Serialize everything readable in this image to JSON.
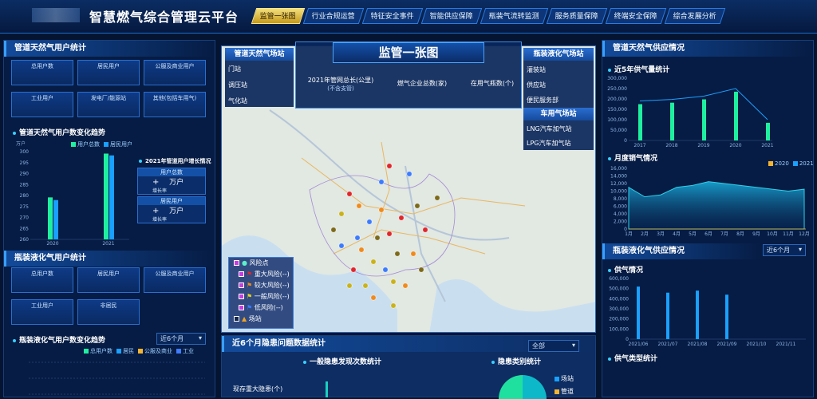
{
  "app": {
    "title": "智慧燃气综合管理云平台"
  },
  "nav": [
    "监管一张图",
    "行业合规运营",
    "特征安全事件",
    "智能供应保障",
    "瓶装气流转监测",
    "服务质量保障",
    "终端安全保障",
    "综合发展分析"
  ],
  "left": {
    "pipeline_title": "管道天然气用户统计",
    "pipeline_tiles": [
      "总用户数",
      "居民用户",
      "公服及商业用户",
      "工业用户",
      "发电厂/能源站",
      "其他(包括车用气)"
    ],
    "trend_title": "管道天然气用户数变化趋势",
    "trend_unit": "万户",
    "trend_legend": [
      "用户总数",
      "居民用户"
    ],
    "growth_title": "2021年管道用户增长情况",
    "growth_boxes": [
      {
        "label": "用户总数",
        "unit": "万户",
        "sub": "增长率"
      },
      {
        "label": "居民用户",
        "unit": "万户",
        "sub": "增长率"
      }
    ],
    "bottled_title": "瓶装液化气用户统计",
    "bottled_tiles": [
      "总用户数",
      "居民用户",
      "公服及商业用户",
      "工业用户",
      "非居民"
    ],
    "bottled_trend_title": "瓶装液化气用户数变化趋势",
    "bottled_select": "近6个月",
    "bottled_legend": [
      "总用户数",
      "居民",
      "公服及商业",
      "工业"
    ]
  },
  "map": {
    "title": "监管一张图",
    "stats": [
      {
        "label": "2021年管网总长(公里)",
        "sub": "(不含支管)"
      },
      {
        "label": "燃气企业总数(家)",
        "sub": ""
      },
      {
        "label": "在用气瓶数(个)",
        "sub": ""
      }
    ],
    "left_list_title": "管道天然气场站",
    "left_list": [
      "门站",
      "调压站",
      "气化站"
    ],
    "right_list_title": "瓶装液化气场站",
    "right_list": [
      "灌装站",
      "供应站",
      "便民服务部"
    ],
    "right_list2_title": "车用气场站",
    "right_list2": [
      "LNG汽车加气站",
      "LPG汽车加气站"
    ],
    "legend": [
      "风险点",
      "重大风险(--)",
      "较大风险(--)",
      "一般风险(--)",
      "低风险(--)",
      "场站"
    ]
  },
  "bottom": {
    "title": "近6个月隐患问题数据统计",
    "select": "全部",
    "sub1": "一般隐患发现次数统计",
    "sub2": "隐患类别统计",
    "major": "现存重大隐患(个)",
    "pie_legend": [
      "场站",
      "管道"
    ]
  },
  "right": {
    "title": "管道天然气供应情况",
    "sub1": "近5年供气量统计",
    "sub2": "月度销气情况",
    "bottled_title": "瓶装液化气供应情况",
    "bottled_select": "近6个月",
    "sub3": "供气情况",
    "sub4": "供气类型统计"
  },
  "chart_data": [
    {
      "type": "bar",
      "title": "管道天然气用户数变化趋势",
      "ylabel": "万户",
      "categories": [
        "2020",
        "2021"
      ],
      "series": [
        {
          "name": "用户总数",
          "values": [
            247,
            296
          ]
        },
        {
          "name": "居民用户",
          "values": [
            244,
            294
          ]
        }
      ],
      "ylim": [
        200,
        300
      ],
      "yticks": [
        "300",
        "295",
        "290",
        "285",
        "280",
        "275",
        "270",
        "265",
        "260"
      ]
    },
    {
      "type": "bar",
      "title": "近5年供气量统计",
      "categories": [
        "2017",
        "2018",
        "2019",
        "2020",
        "2021"
      ],
      "values": [
        175,
        182,
        198,
        235,
        85
      ],
      "ylim": [
        0,
        300
      ],
      "yticks": [
        "300,000",
        "250,000",
        "200,000",
        "150,000",
        "100,000",
        "50,000",
        "0"
      ]
    },
    {
      "type": "area",
      "title": "月度销气情况",
      "categories": [
        "1月",
        "2月",
        "3月",
        "4月",
        "5月",
        "6月",
        "7月",
        "8月",
        "9月",
        "10月",
        "11月",
        "12月"
      ],
      "series": [
        {
          "values": [
            11,
            8.5,
            9,
            11,
            11.5,
            12.5,
            12,
            11.5,
            11,
            10.5,
            10,
            10.5
          ]
        }
      ],
      "ylim": [
        0,
        16
      ],
      "yticks": [
        "16,000",
        "14,000",
        "12,000",
        "10,000",
        "8,000",
        "6,000",
        "4,000",
        "2,000",
        "0"
      ],
      "legend": [
        "2020",
        "2021"
      ]
    },
    {
      "type": "bar",
      "title": "供气情况",
      "categories": [
        "2021/06",
        "2021/07",
        "2021/08",
        "2021/09",
        "2021/10",
        "2021/11"
      ],
      "values": [
        52,
        46,
        48,
        44,
        0,
        0
      ],
      "ylim": [
        0,
        60
      ],
      "yticks": [
        "600,000",
        "500,000",
        "400,000",
        "300,000",
        "200,000",
        "100,000",
        "0"
      ]
    }
  ]
}
